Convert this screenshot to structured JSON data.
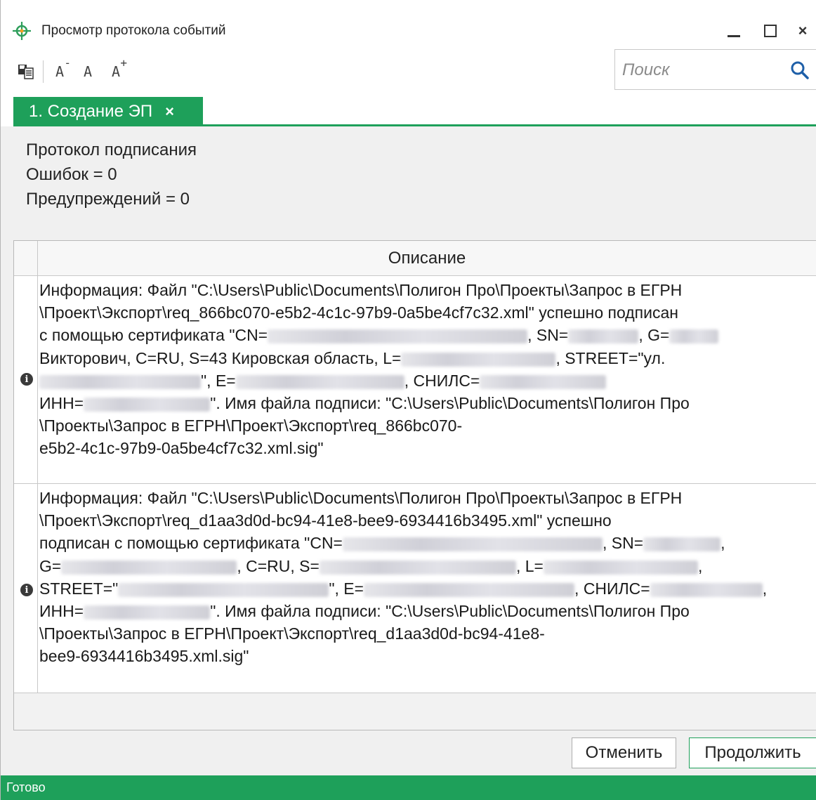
{
  "window": {
    "title": "Просмотр протокола событий",
    "minimize_icon": "minimize-icon",
    "maximize_icon": "maximize-icon",
    "close_label": "×"
  },
  "toolbar": {
    "save_icon": "save-icon",
    "font_decrease_label": "A",
    "font_decrease_mark": "-",
    "font_normal_label": "A",
    "font_increase_label": "A",
    "font_increase_mark": "+"
  },
  "search": {
    "placeholder": "Поиск",
    "icon": "search-icon"
  },
  "tabs": [
    {
      "label": "1. Создание ЭП",
      "close_label": "×",
      "active": true
    }
  ],
  "summary": {
    "title": "Протокол подписания",
    "errors": "Ошибок = 0",
    "warnings": "Предупреждений = 0"
  },
  "grid": {
    "column_header": "Описание",
    "rows": [
      {
        "icon": "info-icon",
        "line1": "Информация: Файл \"C:\\Users\\Public\\Documents\\Полигон Про\\Проекты\\Запрос в ЕГРН",
        "line2": "\\Проект\\Экспорт\\req_866bc070-e5b2-4c1c-97b9-0a5be4cf7c32.xml\" успешно подписан",
        "line3a": "с помощью сертификата \"CN=",
        "line3b": ", SN=",
        "line3c": ", G=",
        "line4a": "Викторович, C=RU, S=43 Кировская область, L=",
        "line4b": ", STREET=\"ул.",
        "line5a": "\", E=",
        "line5b": ", СНИЛС=",
        "line6a": "ИНН=",
        "line6b": "\". Имя файла подписи: \"C:\\Users\\Public\\Documents\\Полигон Про",
        "line7": "\\Проекты\\Запрос в ЕГРН\\Проект\\Экспорт\\req_866bc070-",
        "line8": "e5b2-4c1c-97b9-0a5be4cf7c32.xml.sig\""
      },
      {
        "icon": "info-icon",
        "line1": "Информация: Файл \"C:\\Users\\Public\\Documents\\Полигон Про\\Проекты\\Запрос в ЕГРН",
        "line2": "\\Проект\\Экспорт\\req_d1aa3d0d-bc94-41e8-bee9-6934416b3495.xml\" успешно",
        "line3a": "подписан с помощью сертификата \"CN=",
        "line3b": ", SN=",
        "line3c": ",",
        "line4a": "G=",
        "line4b": ", C=RU, S=",
        "line4c": ", L=",
        "line4d": ",",
        "line5a": "STREET=\"",
        "line5b": "\", E=",
        "line5c": ", СНИЛС=",
        "line5d": ",",
        "line6a": "ИНН=",
        "line6b": "\". Имя файла подписи: \"C:\\Users\\Public\\Documents\\Полигон Про",
        "line7": "\\Проекты\\Запрос в ЕГРН\\Проект\\Экспорт\\req_d1aa3d0d-bc94-41e8-",
        "line8": "bee9-6934416b3495.xml.sig\""
      }
    ]
  },
  "buttons": {
    "cancel": "Отменить",
    "continue": "Продолжить"
  },
  "status": {
    "text": "Готово"
  },
  "colors": {
    "accent": "#1ea05a",
    "icon_green": "#2e9e5b",
    "search_blue": "#1e5fa8"
  }
}
